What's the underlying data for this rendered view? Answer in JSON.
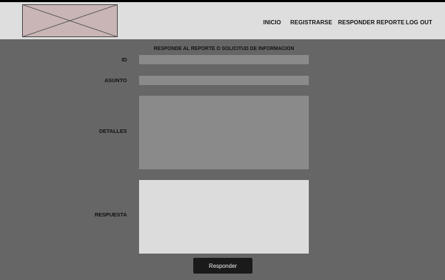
{
  "nav": {
    "items": [
      "INICIO",
      "REGISTRARSE",
      "RESPONDER REPORTE",
      "LOG OUT"
    ]
  },
  "form": {
    "title": "RESPONDE AL REPORTE O SOLICITUD DE INFORMACION",
    "fields": {
      "id": {
        "label": "ID",
        "value": ""
      },
      "asunto": {
        "label": "ASUNTO",
        "value": ""
      },
      "detalles": {
        "label": "DETALLES",
        "value": ""
      },
      "respuesta": {
        "label": "RESPUESTA",
        "value": ""
      }
    },
    "submit_label": "Responder"
  },
  "colors": {
    "page_background": "#666666",
    "header_background": "#dedede",
    "logo_placeholder": "#c9b5b5",
    "readonly_field": "#8a8a8a",
    "editable_field": "#dcdcdc",
    "button": "#1a1a1a"
  },
  "icons": {
    "logo": "image-placeholder-icon"
  }
}
